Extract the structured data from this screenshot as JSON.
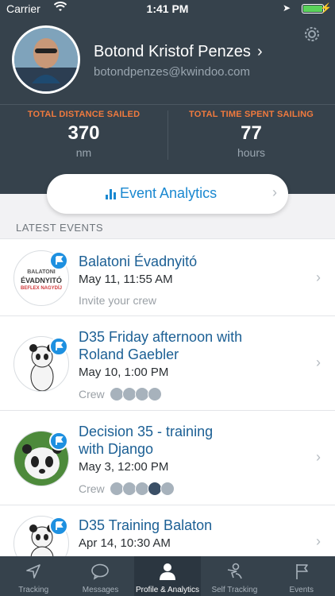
{
  "status": {
    "carrier": "Carrier",
    "time": "1:41 PM"
  },
  "profile": {
    "name": "Botond Kristof Penzes",
    "email": "botondpenzes@kwindoo.com"
  },
  "stats": [
    {
      "label": "TOTAL DISTANCE SAILED",
      "value": "370",
      "unit": "nm"
    },
    {
      "label": "TOTAL TIME SPENT SAILING",
      "value": "77",
      "unit": "hours"
    }
  ],
  "analytics": {
    "label": "Event Analytics"
  },
  "section": {
    "label": "LATEST EVENTS"
  },
  "events": [
    {
      "title_lines": [
        "Balatoni Évadnyitó"
      ],
      "date": "May 11, 11:55 AM",
      "sub": "Invite your crew",
      "crew_label": "",
      "thumb_text": [
        "BALATONI",
        "ÉVADNYITÓ",
        "BEFLEX NAGYDÍJ"
      ]
    },
    {
      "title_lines": [
        "D35 Friday afternoon with",
        "Roland Gaebler"
      ],
      "date": "May 10, 1:00 PM",
      "sub": "",
      "crew_label": "Crew"
    },
    {
      "title_lines": [
        "Decision 35 - training",
        "with Django"
      ],
      "date": "May 3, 12:00 PM",
      "sub": "",
      "crew_label": "Crew"
    },
    {
      "title_lines": [
        "D35 Training Balaton"
      ],
      "date": "Apr 14, 10:30 AM",
      "sub": "",
      "crew_label": ""
    }
  ],
  "tabs": [
    {
      "label": "Tracking",
      "icon": "navigation-arrow-icon",
      "active": false
    },
    {
      "label": "Messages",
      "icon": "chat-bubble-icon",
      "active": false
    },
    {
      "label": "Profile & Analytics",
      "icon": "person-icon",
      "active": true
    },
    {
      "label": "Self Tracking",
      "icon": "self-tracking-icon",
      "active": false
    },
    {
      "label": "Events",
      "icon": "flag-icon",
      "active": false
    }
  ],
  "colors": {
    "header": "#36424c",
    "accent": "#1a88d0",
    "stat_label": "#f07a3e",
    "title": "#1b5f94"
  }
}
